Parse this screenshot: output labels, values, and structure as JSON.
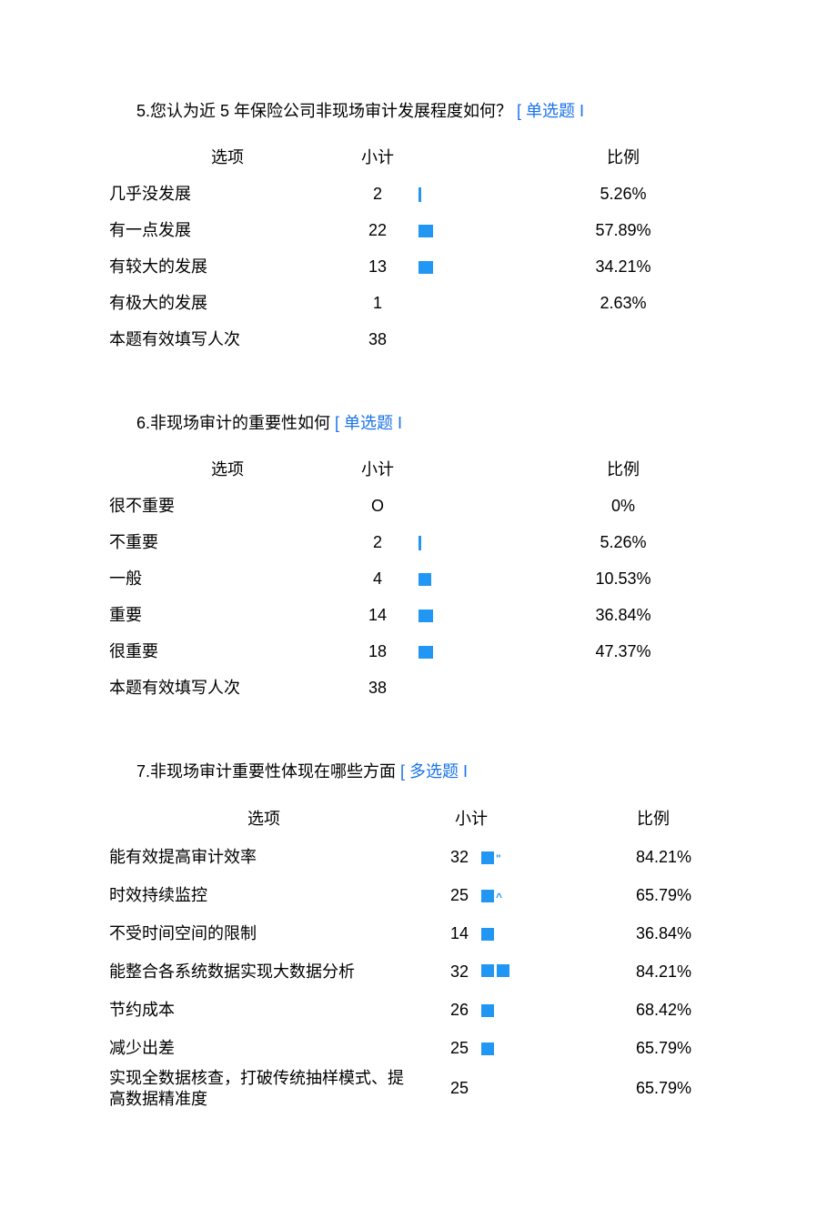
{
  "labels": {
    "option_header": "选项",
    "subtotal_header": "小计",
    "ratio_header": "比例",
    "valid_responses": "本题有效填写人次"
  },
  "q5": {
    "number": "5.",
    "text": "您认为近 5 年保险公司非现场审计发展程度如何？",
    "type_label": "[ 单选题 I",
    "rows": [
      {
        "option": "几乎没发展",
        "subtotal": "2",
        "ratio": "5.26%"
      },
      {
        "option": "有一点发展",
        "subtotal": "22",
        "ratio": "57.89%"
      },
      {
        "option": "有较大的发展",
        "subtotal": "13",
        "ratio": "34.21%"
      },
      {
        "option": "有极大的发展",
        "subtotal": "1",
        "ratio": "2.63%"
      }
    ],
    "valid_count": "38"
  },
  "q6": {
    "number": "6.",
    "text": "非现场审计的重要性如何",
    "type_label": "[ 单选题 I",
    "rows": [
      {
        "option": "很不重要",
        "subtotal": "O",
        "ratio": "0%"
      },
      {
        "option": "不重要",
        "subtotal": "2",
        "ratio": "5.26%"
      },
      {
        "option": "一般",
        "subtotal": "4",
        "ratio": "10.53%"
      },
      {
        "option": "重要",
        "subtotal": "14",
        "ratio": "36.84%"
      },
      {
        "option": "很重要",
        "subtotal": "18",
        "ratio": "47.37%"
      }
    ],
    "valid_count": "38"
  },
  "q7": {
    "number": "7.",
    "text": "非现场审计重要性体现在哪些方面",
    "type_label": "[ 多选题 I",
    "rows": [
      {
        "option": "能有效提高审计效率",
        "subtotal": "32",
        "ratio": "84.21%"
      },
      {
        "option": "时效持续监控",
        "subtotal": "25",
        "ratio": "65.79%"
      },
      {
        "option": "不受时间空间的限制",
        "subtotal": "14",
        "ratio": "36.84%"
      },
      {
        "option": "能整合各系统数据实现大数据分析",
        "subtotal": "32",
        "ratio": "84.21%"
      },
      {
        "option": "节约成本",
        "subtotal": "26",
        "ratio": "68.42%"
      },
      {
        "option": "减少出差",
        "subtotal": "25",
        "ratio": "65.79%"
      },
      {
        "option": "实现全数据核查，打破传统抽样模式、提高数据精准度",
        "subtotal": "25",
        "ratio": "65.79%"
      }
    ]
  },
  "chart_data": [
    {
      "type": "bar",
      "title": "您认为近 5 年保险公司非现场审计发展程度如何？",
      "categories": [
        "几乎没发展",
        "有一点发展",
        "有较大的发展",
        "有极大的发展"
      ],
      "values": [
        2,
        22,
        13,
        1
      ],
      "percentages": [
        5.26,
        57.89,
        34.21,
        2.63
      ],
      "n": 38
    },
    {
      "type": "bar",
      "title": "非现场审计的重要性如何",
      "categories": [
        "很不重要",
        "不重要",
        "一般",
        "重要",
        "很重要"
      ],
      "values": [
        0,
        2,
        4,
        14,
        18
      ],
      "percentages": [
        0,
        5.26,
        10.53,
        36.84,
        47.37
      ],
      "n": 38
    },
    {
      "type": "bar",
      "title": "非现场审计重要性体现在哪些方面",
      "categories": [
        "能有效提高审计效率",
        "时效持续监控",
        "不受时间空间的限制",
        "能整合各系统数据实现大数据分析",
        "节约成本",
        "减少出差",
        "实现全数据核查，打破传统抽样模式、提高数据精准度"
      ],
      "values": [
        32,
        25,
        14,
        32,
        26,
        25,
        25
      ],
      "percentages": [
        84.21,
        65.79,
        36.84,
        84.21,
        68.42,
        65.79,
        65.79
      ]
    }
  ]
}
